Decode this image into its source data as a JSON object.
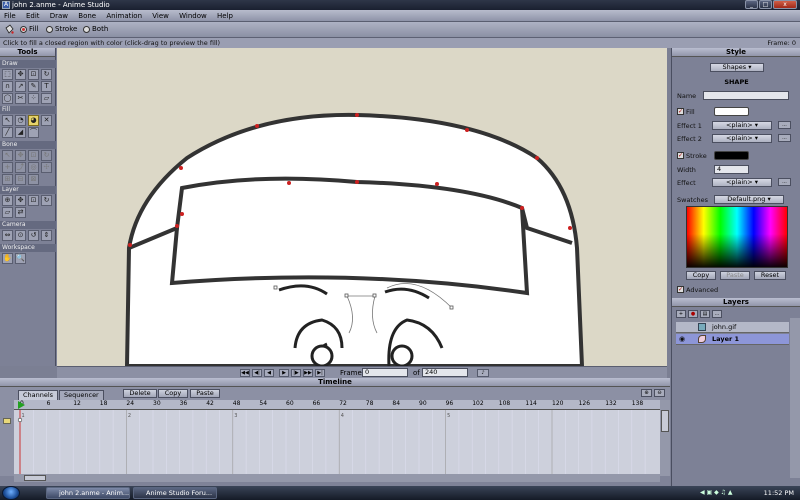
{
  "window": {
    "title": "john 2.anme - Anime Studio",
    "minimize": "_",
    "maximize": "□",
    "close": "x"
  },
  "menu": [
    "File",
    "Edit",
    "Draw",
    "Bone",
    "Animation",
    "View",
    "Window",
    "Help"
  ],
  "tool_options": {
    "fill": "Fill",
    "stroke": "Stroke",
    "both": "Both",
    "selected": "Fill"
  },
  "status": {
    "hint": "Click to fill a closed region with color (click-drag to preview the fill)",
    "frame": "Frame: 0"
  },
  "tools_panel": {
    "title": "Tools",
    "sections": {
      "draw": "Draw",
      "fill": "Fill",
      "bone": "Bone",
      "layer": "Layer",
      "camera": "Camera",
      "workspace": "Workspace"
    },
    "draw_icons": [
      "select-points",
      "translate-points",
      "scale-points",
      "rotate-points",
      "add-point",
      "curvature",
      "freehand",
      "text",
      "shape",
      "delete-edge",
      "scatter",
      "perspective"
    ],
    "fill_icons": [
      "select-shape",
      "create-shape",
      "paint-bucket",
      "delete-shape",
      "line-width",
      "hide-edge",
      "stroke-exposure"
    ],
    "active_tool": "paint-bucket",
    "bone_icons": [
      "select-bone",
      "translate-bone",
      "scale-bone",
      "rotate-bone",
      "add-bone",
      "reparent-bone",
      "bone-strength",
      "manipulate-bones",
      "bind-layer",
      "bind-points",
      "offset-bone"
    ],
    "layer_icons": [
      "set-origin",
      "translate-layer",
      "scale-layer",
      "rotate-layer",
      "shear-layer",
      "switch-layer"
    ],
    "camera_icons": [
      "track-camera",
      "zoom-camera",
      "roll-camera",
      "pan-tilt-camera"
    ],
    "workspace_icons": [
      "hand-tool",
      "zoom-tool"
    ]
  },
  "canvas_bar": {
    "frame_label": "Frame",
    "frame_value": "0",
    "of_label": "of",
    "of_value": "240"
  },
  "timeline": {
    "title": "Timeline",
    "tabs": [
      "Channels",
      "Sequencer"
    ],
    "active_tab": "Channels",
    "buttons": {
      "delete": "Delete",
      "copy": "Copy",
      "paste": "Paste"
    },
    "ruler": [
      "0",
      "6",
      "12",
      "18",
      "24",
      "30",
      "36",
      "42",
      "48",
      "54",
      "60",
      "66",
      "72",
      "78",
      "84",
      "90",
      "96",
      "102",
      "108",
      "114",
      "120",
      "126",
      "132",
      "138"
    ],
    "markers": [
      "1",
      "2",
      "3",
      "4",
      "5"
    ]
  },
  "style_panel": {
    "title": "Style",
    "shapes_dropdown": "Shapes",
    "section": "SHAPE",
    "name_label": "Name",
    "name_value": "",
    "fill_label": "Fill",
    "fill_color": "#ffffff",
    "effect1_label": "Effect 1",
    "effect1_value": "<plain>",
    "effect2_label": "Effect 2",
    "effect2_value": "<plain>",
    "stroke_label": "Stroke",
    "stroke_color": "#000000",
    "width_label": "Width",
    "width_value": "4",
    "effect_label": "Effect",
    "effect_value": "<plain>",
    "swatches_label": "Swatches",
    "swatches_value": "Default.png",
    "copy": "Copy",
    "paste": "Paste",
    "reset": "Reset",
    "advanced": "Advanced",
    "more": "..."
  },
  "layers_panel": {
    "title": "Layers",
    "rows": [
      {
        "name": "john.gif",
        "type": "image",
        "selected": false
      },
      {
        "name": "Layer 1",
        "type": "vector",
        "selected": true
      }
    ]
  },
  "taskbar": {
    "items": [
      {
        "label": "john 2.anme - Anim...",
        "active": true
      },
      {
        "label": "Anime Studio Foru...",
        "active": false
      }
    ],
    "clock": "11:52 PM"
  },
  "colors": {
    "accent": "#8d96d8",
    "point_red": "#cc2020",
    "canvas_bg": "#dcd8c7",
    "playhead_green": "#22a020"
  }
}
